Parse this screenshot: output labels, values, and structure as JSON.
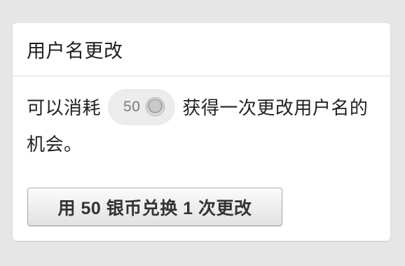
{
  "card": {
    "title": "用户名更改",
    "message_before": "可以消耗",
    "cost_amount": "50",
    "message_after": "获得一次更改用户名的机会。",
    "coin_icon": "silver-coin-icon",
    "redeem_button_label": "用 50 银币兑换 1 次更改"
  }
}
